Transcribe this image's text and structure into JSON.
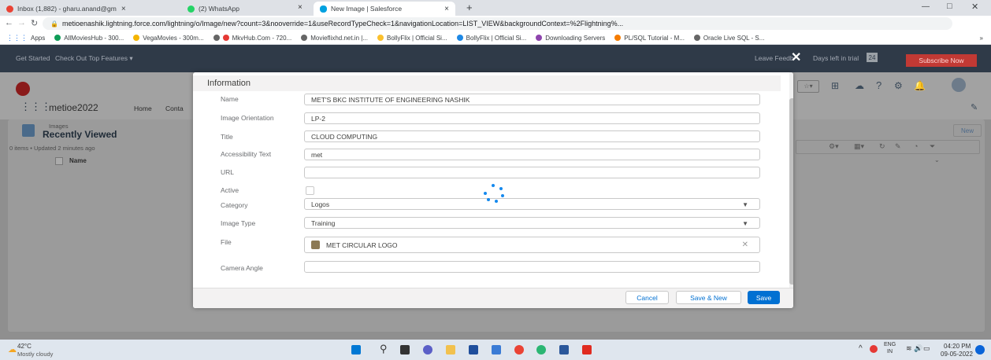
{
  "browser": {
    "tabs": [
      {
        "label": "Inbox (1,882) - gharu.anand@gm",
        "close": "×"
      },
      {
        "label": "(2) WhatsApp",
        "close": "×"
      },
      {
        "label": "New Image | Salesforce",
        "close": "×"
      }
    ],
    "new_tab": "+",
    "url": "metioenashik.lightning.force.com/lightning/o/Image/new?count=3&nooverride=1&useRecordTypeCheck=1&navigationLocation=LIST_VIEW&backgroundContext=%2Flightning%...",
    "bookmarks": [
      "Apps",
      "AllMoviesHub - 300...",
      "VegaMovies - 300m...",
      "MkvHub.Com - 720...",
      "Movieflixhd.net.in |...",
      "BollyFlix | Official Si...",
      "BollyFlix | Official Si...",
      "Downloading Servers",
      "PL/SQL Tutorial - M...",
      "Oracle Live SQL - S..."
    ],
    "bookmarks_more": "»"
  },
  "trialbar": {
    "get_started": "Get Started",
    "features": "Check Out Top Features ▾",
    "leave_feedback": "Leave Feedb",
    "days_left_label": "Days left in trial",
    "days_left": "24",
    "subscribe": "Subscribe Now"
  },
  "app": {
    "name": "metioe2022",
    "nav_home": "Home",
    "nav_contacts": "Conta"
  },
  "list": {
    "object": "Images",
    "title": "Recently Viewed",
    "meta": "0 items • Updated 2 minutes ago",
    "column": "Name",
    "new_button": "New"
  },
  "modal": {
    "section_title": "Information",
    "fields": [
      {
        "label": "Name",
        "value": "MET'S BKC INSTITUTE OF ENGINEERING NASHIK"
      },
      {
        "label": "Image Orientation",
        "value": "LP-2"
      },
      {
        "label": "Title",
        "value": "CLOUD COMPUTING"
      },
      {
        "label": "Accessibility Text",
        "value": "met"
      },
      {
        "label": "URL",
        "value": ""
      },
      {
        "label": "Active",
        "value": ""
      },
      {
        "label": "Category",
        "value": "Logos"
      },
      {
        "label": "Image Type",
        "value": "Training"
      },
      {
        "label": "File",
        "value": "MET CIRCULAR LOGO"
      },
      {
        "label": "Camera Angle",
        "value": ""
      }
    ],
    "cancel": "Cancel",
    "save_new": "Save & New",
    "save": "Save"
  },
  "taskbar": {
    "temperature": "42°C",
    "weather": "Mostly cloudy",
    "lang1": "ENG",
    "lang2": "IN",
    "time": "04:20 PM",
    "date": "09-05-2022"
  },
  "colors": {
    "accent": "#0070d2",
    "subscribe": "#c23934",
    "trialbar": "#2f3a48"
  }
}
